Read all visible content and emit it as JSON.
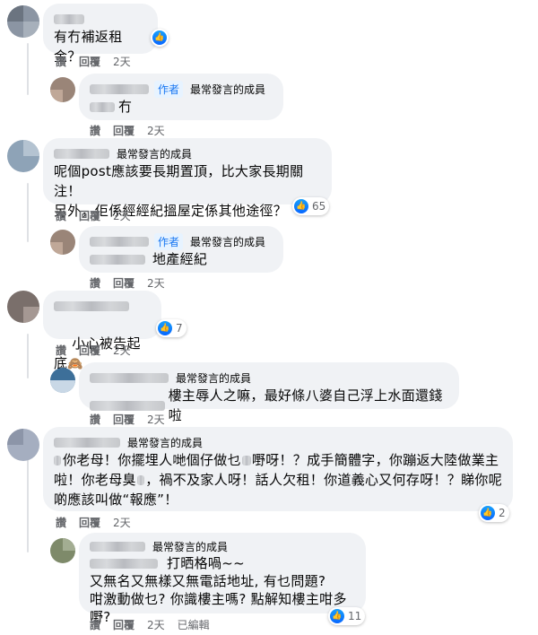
{
  "actions": {
    "like": "讚",
    "reply": "回覆",
    "edited": "已編輯"
  },
  "badges": {
    "author": "作者",
    "top_fan": "最常發言的成員"
  },
  "comments": [
    {
      "text": "有冇補返租金？",
      "time": "2天"
    },
    {
      "text": "冇",
      "time": "2天"
    },
    {
      "text": "呢個post應該要長期置頂，比大家長期關注！\n另外，佢係經經紀搵屋定係其他途徑？",
      "time": "2天",
      "likes": "65"
    },
    {
      "text": "地產經紀",
      "time": "2天"
    },
    {
      "text": "小心被告起底",
      "emoji": "🙈",
      "time": "2天",
      "likes": "7"
    },
    {
      "text": "樓主辱人之嘛，最好條八婆自己浮上水面還錢啦",
      "time": "2天"
    },
    {
      "line1": "你老母！你擺埋人哋個仔做乜",
      "line1b": "嘢呀！？成手簡體字，你蹦返大陸做業主",
      "line2": "啦！你老母臭",
      "line2b": "，禍不及家人呀！話人欠租！你道義心又何存呀！？睇你呢",
      "line3": "啲應該叫做“報應”！",
      "time": "2天",
      "likes": "2"
    },
    {
      "line1": "打晒格喎~~",
      "line2": "又無名又無樣又無電話地址, 有乜問題?",
      "line3": "咁激動做乜? 你識樓主嗎? 點解知樓主咁多嘢?",
      "time": "2天",
      "likes": "11"
    }
  ],
  "colors": {
    "link": "#1877f2",
    "bubble": "#f0f2f5",
    "meta": "#65676b"
  }
}
